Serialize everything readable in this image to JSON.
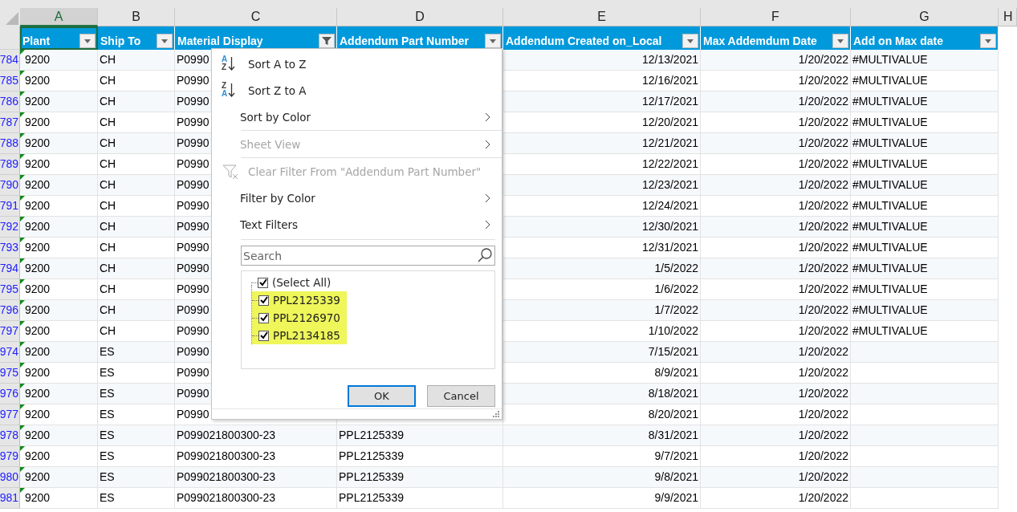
{
  "column_letters": [
    {
      "label": "A",
      "selected": true
    },
    {
      "label": "B",
      "selected": false
    },
    {
      "label": "C",
      "selected": false
    },
    {
      "label": "D",
      "selected": false
    },
    {
      "label": "E",
      "selected": false
    },
    {
      "label": "F",
      "selected": false
    },
    {
      "label": "G",
      "selected": false
    },
    {
      "label": "H",
      "selected": false
    }
  ],
  "header": [
    {
      "label": "Plant",
      "selected": true,
      "filtered": false
    },
    {
      "label": "Ship To",
      "selected": false,
      "filtered": false
    },
    {
      "label": "Material Display",
      "selected": false,
      "filtered": true
    },
    {
      "label": "Addendum Part Number",
      "selected": false,
      "filtered": false
    },
    {
      "label": "Addendum Created on_Local",
      "selected": false,
      "filtered": false
    },
    {
      "label": "Max Addemdum Date",
      "selected": false,
      "filtered": false
    },
    {
      "label": "Add on Max date",
      "selected": false,
      "filtered": false
    }
  ],
  "rows": [
    {
      "row": "784",
      "plant": "9200",
      "ship_to": "CH",
      "material": "P0990",
      "created": "12/13/2021",
      "max_date": "1/20/2022",
      "add_on": "#MULTIVALUE"
    },
    {
      "row": "785",
      "plant": "9200",
      "ship_to": "CH",
      "material": "P0990",
      "created": "12/16/2021",
      "max_date": "1/20/2022",
      "add_on": "#MULTIVALUE"
    },
    {
      "row": "786",
      "plant": "9200",
      "ship_to": "CH",
      "material": "P0990",
      "created": "12/17/2021",
      "max_date": "1/20/2022",
      "add_on": "#MULTIVALUE"
    },
    {
      "row": "787",
      "plant": "9200",
      "ship_to": "CH",
      "material": "P0990",
      "created": "12/20/2021",
      "max_date": "1/20/2022",
      "add_on": "#MULTIVALUE"
    },
    {
      "row": "788",
      "plant": "9200",
      "ship_to": "CH",
      "material": "P0990",
      "created": "12/21/2021",
      "max_date": "1/20/2022",
      "add_on": "#MULTIVALUE"
    },
    {
      "row": "789",
      "plant": "9200",
      "ship_to": "CH",
      "material": "P0990",
      "created": "12/22/2021",
      "max_date": "1/20/2022",
      "add_on": "#MULTIVALUE"
    },
    {
      "row": "790",
      "plant": "9200",
      "ship_to": "CH",
      "material": "P0990",
      "created": "12/23/2021",
      "max_date": "1/20/2022",
      "add_on": "#MULTIVALUE"
    },
    {
      "row": "791",
      "plant": "9200",
      "ship_to": "CH",
      "material": "P0990",
      "created": "12/24/2021",
      "max_date": "1/20/2022",
      "add_on": "#MULTIVALUE"
    },
    {
      "row": "792",
      "plant": "9200",
      "ship_to": "CH",
      "material": "P0990",
      "created": "12/30/2021",
      "max_date": "1/20/2022",
      "add_on": "#MULTIVALUE"
    },
    {
      "row": "793",
      "plant": "9200",
      "ship_to": "CH",
      "material": "P0990",
      "created": "12/31/2021",
      "max_date": "1/20/2022",
      "add_on": "#MULTIVALUE"
    },
    {
      "row": "794",
      "plant": "9200",
      "ship_to": "CH",
      "material": "P0990",
      "created": "1/5/2022",
      "max_date": "1/20/2022",
      "add_on": "#MULTIVALUE"
    },
    {
      "row": "795",
      "plant": "9200",
      "ship_to": "CH",
      "material": "P0990",
      "created": "1/6/2022",
      "max_date": "1/20/2022",
      "add_on": "#MULTIVALUE"
    },
    {
      "row": "796",
      "plant": "9200",
      "ship_to": "CH",
      "material": "P0990",
      "created": "1/7/2022",
      "max_date": "1/20/2022",
      "add_on": "#MULTIVALUE"
    },
    {
      "row": "797",
      "plant": "9200",
      "ship_to": "CH",
      "material": "P0990",
      "created": "1/10/2022",
      "max_date": "1/20/2022",
      "add_on": "#MULTIVALUE"
    },
    {
      "row": "974",
      "plant": "9200",
      "ship_to": "ES",
      "material": "P0990",
      "created": "7/15/2021",
      "max_date": "1/20/2022"
    },
    {
      "row": "975",
      "plant": "9200",
      "ship_to": "ES",
      "material": "P0990",
      "created": "8/9/2021",
      "max_date": "1/20/2022"
    },
    {
      "row": "976",
      "plant": "9200",
      "ship_to": "ES",
      "material": "P0990",
      "created": "8/18/2021",
      "max_date": "1/20/2022"
    },
    {
      "row": "977",
      "plant": "9200",
      "ship_to": "ES",
      "material": "P0990",
      "created": "8/20/2021",
      "max_date": "1/20/2022"
    },
    {
      "row": "978",
      "plant": "9200",
      "ship_to": "ES",
      "material": "P099021800300-23",
      "part": "PPL2125339",
      "created": "8/31/2021",
      "max_date": "1/20/2022"
    },
    {
      "row": "979",
      "plant": "9200",
      "ship_to": "ES",
      "material": "P099021800300-23",
      "part": "PPL2125339",
      "created": "9/7/2021",
      "max_date": "1/20/2022"
    },
    {
      "row": "980",
      "plant": "9200",
      "ship_to": "ES",
      "material": "P099021800300-23",
      "part": "PPL2125339",
      "created": "9/8/2021",
      "max_date": "1/20/2022"
    },
    {
      "row": "981",
      "plant": "9200",
      "ship_to": "ES",
      "material": "P099021800300-23",
      "part": "PPL2125339",
      "created": "9/9/2021",
      "max_date": "1/20/2022"
    }
  ],
  "filter_menu": {
    "items": [
      {
        "kind": "sort-asc",
        "label": "Sort A to Z",
        "disabled": false,
        "icon_text": [
          "A",
          "Z"
        ]
      },
      {
        "kind": "sort-desc",
        "label": "Sort Z to A",
        "disabled": false,
        "icon_text": [
          "Z",
          "A"
        ]
      },
      {
        "kind": "submenu",
        "label": "Sort by Color",
        "disabled": false
      },
      {
        "kind": "separator"
      },
      {
        "kind": "submenu",
        "label": "Sheet View",
        "disabled": true
      },
      {
        "kind": "separator"
      },
      {
        "kind": "clear-filter",
        "label": "Clear Filter From \"Addendum Part Number\"",
        "disabled": true
      },
      {
        "kind": "submenu",
        "label": "Filter by Color",
        "disabled": false
      },
      {
        "kind": "submenu",
        "label": "Text Filters",
        "disabled": false
      }
    ],
    "search": {
      "placeholder": "Search"
    },
    "values": [
      {
        "label": "(Select All)",
        "checked": true,
        "highlighted": false,
        "children": [
          {
            "label": "PPL2125339",
            "checked": true,
            "highlighted": true
          },
          {
            "label": "PPL2126970",
            "checked": true,
            "highlighted": true
          },
          {
            "label": "PPL2134185",
            "checked": true,
            "highlighted": true
          }
        ]
      }
    ],
    "buttons": [
      {
        "label": "OK",
        "kind": "primary"
      },
      {
        "label": "Cancel",
        "kind": "secondary"
      }
    ]
  }
}
